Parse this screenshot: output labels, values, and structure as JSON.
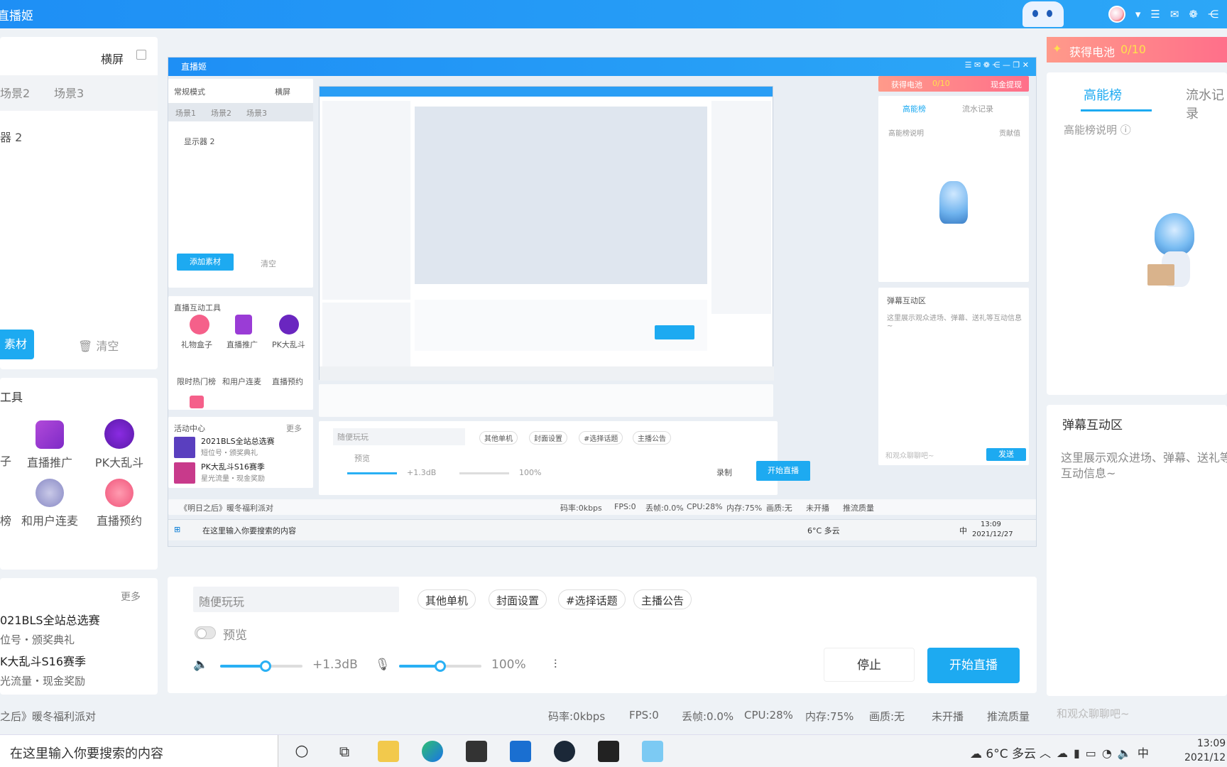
{
  "app": {
    "title": "直播姬"
  },
  "scene": {
    "mode": "横屏",
    "tabs": [
      "场景2",
      "场景3"
    ],
    "display_item": "器 2",
    "add_label": "素材",
    "clear_label": "清空"
  },
  "tools": {
    "title": "工具",
    "items": [
      {
        "label": "直播推广"
      },
      {
        "label": "PK大乱斗"
      },
      {
        "label": "和用户连麦"
      },
      {
        "label": "直播预约"
      },
      {
        "label": "榜"
      },
      {
        "label": "子"
      }
    ]
  },
  "activity": {
    "more": "更多",
    "items": [
      {
        "title": "021BLS全站总选赛",
        "sub": "位号・颁奖典礼"
      },
      {
        "title": "K大乱斗S16赛季",
        "sub": "光流量・现金奖励"
      }
    ]
  },
  "preview": {
    "window_title": "直播姬",
    "mini_mode": "常规模式",
    "mini_orient": "横屏",
    "mini_tabs": [
      "场景1",
      "场景2",
      "场景3"
    ],
    "mini_display": "显示器 2",
    "mini_add": "添加素材",
    "mini_clear": "清空",
    "mini_tools_title": "直播互动工具",
    "mini_tools": [
      "礼物盒子",
      "直播推广",
      "PK大乱斗",
      "限时热门榜",
      "和用户连麦",
      "直播预约"
    ],
    "mini_activity_title": "活动中心",
    "mini_activity_more": "更多",
    "mini_activities": [
      {
        "title": "2021BLS全站总选赛",
        "sub": "短位号・颁奖典礼"
      },
      {
        "title": "PK大乱斗S16赛季",
        "sub": "星光流量・现金奖励"
      }
    ],
    "mini_topic": "随便玩玩",
    "mini_tags": [
      "其他单机",
      "封面设置",
      "#选择话题",
      "主播公告"
    ],
    "mini_preview": "预览",
    "mini_vol": "+1.3dB",
    "mini_mic": "100%",
    "mini_record": "录制",
    "mini_start": "开始直播",
    "mini_status_left": "《明日之后》暖冬福利派对",
    "mini_status": [
      "码率:0kbps",
      "FPS:0",
      "丢帧:0.0%",
      "CPU:28%",
      "内存:75%",
      "画质:无",
      "未开播",
      "推流质量"
    ],
    "mini_battery": "获得电池",
    "mini_battery_count": "0/10",
    "mini_cash": "现金提现",
    "mini_rank_tab": "高能榜",
    "mini_flow_tab": "流水记录",
    "mini_rank_desc": "高能榜说明",
    "mini_rank_value": "贡献值",
    "mini_chat_title": "弹幕互动区",
    "mini_chat_desc": "这里展示观众进场、弹幕、送礼等互动信息~",
    "mini_chat_input": "和观众聊聊吧~",
    "mini_send": "发送",
    "mini_search": "在这里输入你要搜索的内容",
    "mini_weather": "6°C 多云",
    "mini_time": "13:09",
    "mini_date": "2021/12/27",
    "mini_ime": "中"
  },
  "controls": {
    "topic": "随便玩玩",
    "tags": [
      "其他单机",
      "封面设置",
      "#选择话题",
      "主播公告"
    ],
    "preview_label": "预览",
    "volume": "+1.3dB",
    "mic": "100%",
    "volume_level": 0.55,
    "mic_level": 0.5,
    "stop_label": "停止",
    "start_label": "开始直播"
  },
  "status": {
    "left": "之后》暖冬福利派对",
    "bitrate": "码率:0kbps",
    "fps": "FPS:0",
    "drop": "丢帧:0.0%",
    "cpu": "CPU:28%",
    "mem": "内存:75%",
    "quality": "画质:无",
    "live": "未开播",
    "push": "推流质量"
  },
  "right": {
    "battery": "获得电池",
    "battery_count": "0/10",
    "rank_tab": "高能榜",
    "flow_tab": "流水记录",
    "rank_desc": "高能榜说明",
    "chat_title": "弹幕互动区",
    "chat_desc": "这里展示观众进场、弹幕、送礼等互动信息~",
    "chat_input": "和观众聊聊吧~"
  },
  "taskbar": {
    "search": "在这里输入你要搜索的内容",
    "weather": "6°C 多云",
    "ime": "中",
    "time": "13:09",
    "date": "2021/12"
  }
}
